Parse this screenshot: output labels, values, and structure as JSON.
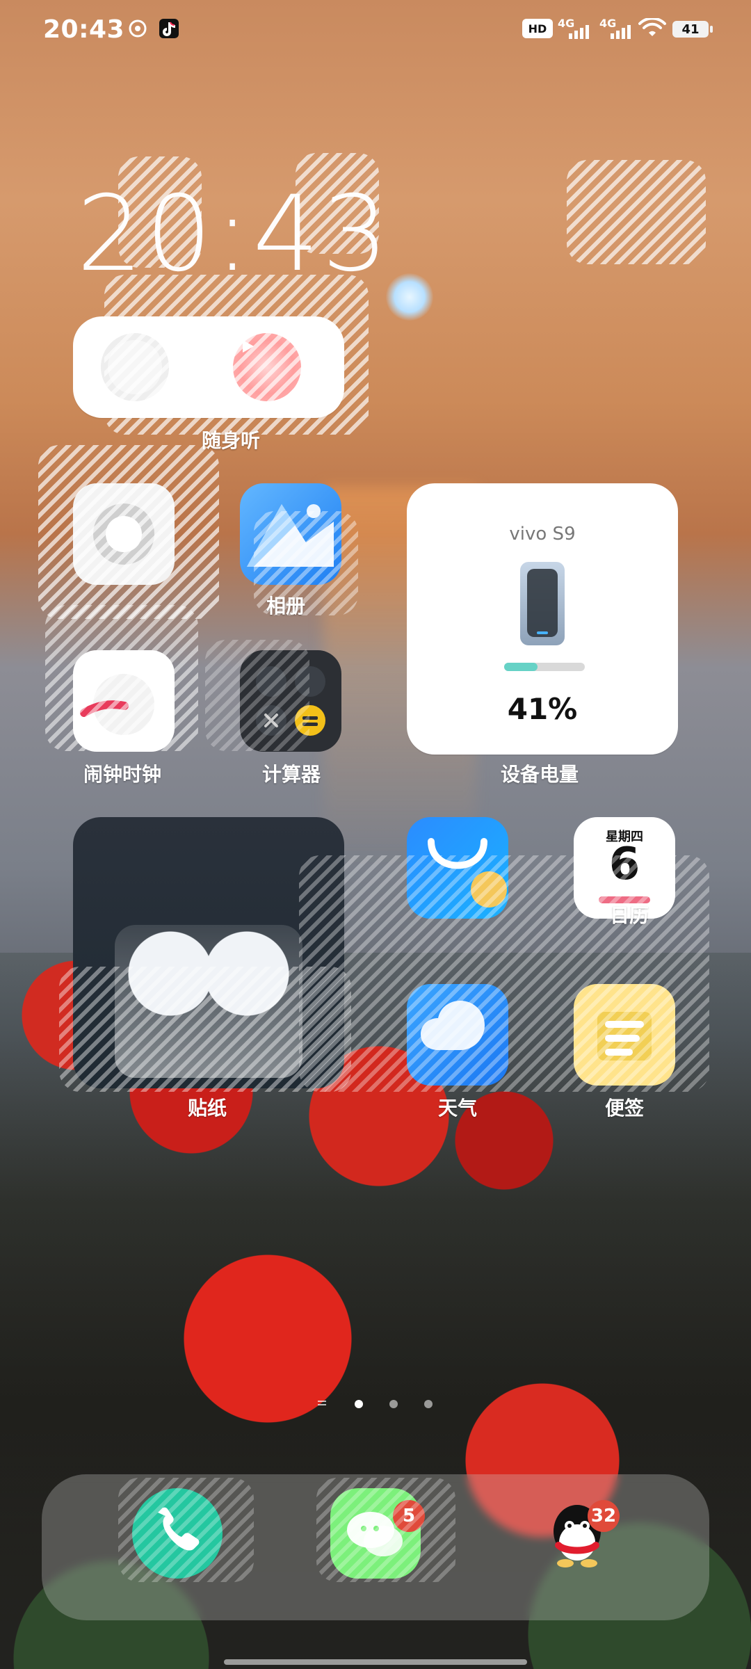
{
  "status_bar": {
    "time": "20:43",
    "battery_percent": "41",
    "hd_label": "HD",
    "sim_labels": [
      "4G",
      "4G"
    ]
  },
  "lockscreen": {
    "big_clock_text": "20:43"
  },
  "widgets": {
    "music_label": "随身听",
    "device_battery": {
      "device_name": "vivo S9",
      "percent_text": "41%",
      "level": 0.41,
      "label": "设备电量"
    },
    "sticker_label": "贴纸",
    "calendar": {
      "weekday": "星期四",
      "day": "6",
      "label": "日历"
    }
  },
  "apps": [
    {
      "label": "相册"
    },
    {
      "label": "闹钟时钟"
    },
    {
      "label": "计算器"
    },
    {
      "label": "天气"
    },
    {
      "label": "便签"
    }
  ],
  "dock": {
    "apps": [
      {
        "name": "phone",
        "icon": "phone-icon",
        "badge": ""
      },
      {
        "name": "wechat",
        "icon": "wechat-icon",
        "badge": "5"
      },
      {
        "name": "qq",
        "icon": "qq-icon",
        "badge": "32"
      }
    ]
  },
  "pager": {
    "pages": 3,
    "active_index": 0
  },
  "colors": {
    "accent_green": "#7cf07b",
    "battery_teal": "#66d2c6",
    "badge_red": "#e04a3a"
  }
}
